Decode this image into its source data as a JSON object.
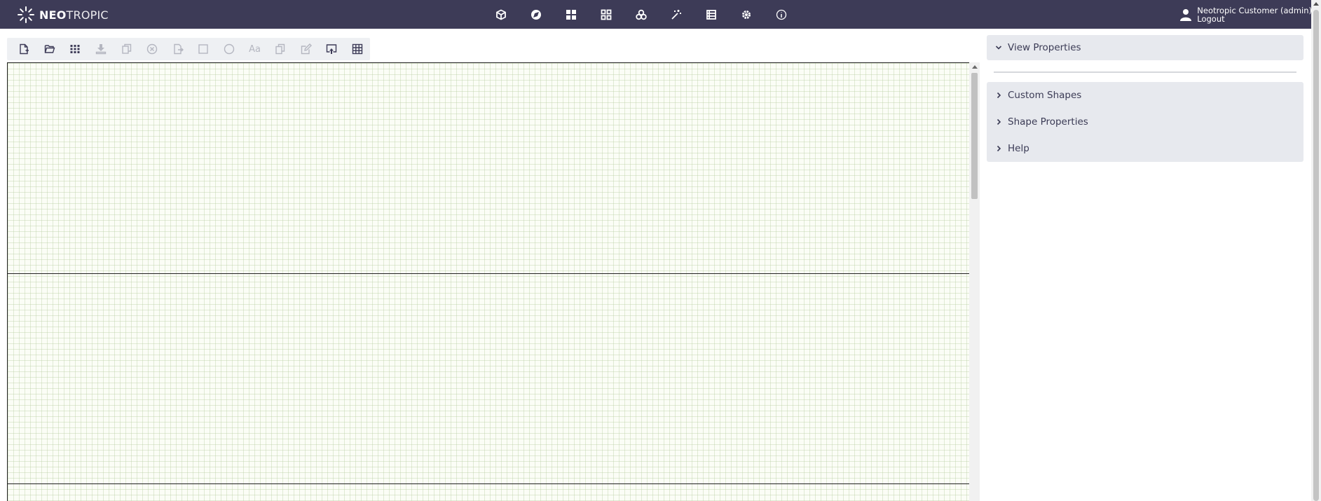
{
  "app": {
    "brand_bold": "NEO",
    "brand_light": "TROPIC"
  },
  "nav": {
    "icons": [
      "cube-icon",
      "compass-icon",
      "dashboard-icon",
      "grid-icon",
      "circles-icon",
      "wand-icon",
      "list-icon",
      "gear-icon",
      "info-icon"
    ]
  },
  "user": {
    "name": "Neotropic Customer (admin)",
    "logout_label": "Logout"
  },
  "toolbar": {
    "tools": [
      {
        "icon": "new-file-icon",
        "enabled": true
      },
      {
        "icon": "open-folder-icon",
        "enabled": true
      },
      {
        "icon": "dots-grid-icon",
        "enabled": true
      },
      {
        "icon": "download-icon",
        "enabled": false
      },
      {
        "icon": "copy-icon",
        "enabled": false
      },
      {
        "icon": "delete-circle-icon",
        "enabled": false
      },
      {
        "icon": "export-icon",
        "enabled": false
      },
      {
        "icon": "rectangle-icon",
        "enabled": false
      },
      {
        "icon": "circle-icon",
        "enabled": false
      },
      {
        "icon": "text-icon",
        "enabled": false
      },
      {
        "icon": "duplicate-icon",
        "enabled": false
      },
      {
        "icon": "edit-icon",
        "enabled": false
      },
      {
        "icon": "screen-export-icon",
        "enabled": true
      },
      {
        "icon": "table-icon",
        "enabled": true
      }
    ],
    "text_tool_label": "Aa"
  },
  "panel": {
    "view_properties": "View Properties",
    "custom_shapes": "Custom Shapes",
    "shape_properties": "Shape Properties",
    "help": "Help"
  }
}
